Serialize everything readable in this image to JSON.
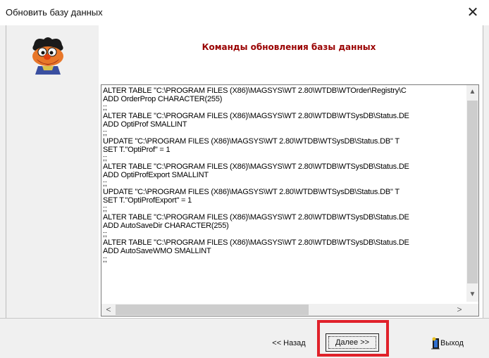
{
  "window": {
    "title": "Обновить базу данных",
    "close_label": "✕"
  },
  "header": {
    "title": "Команды обновления базы данных"
  },
  "sql_text": "ALTER TABLE \"C:\\PROGRAM FILES (X86)\\MAGSYS\\WT 2.80\\WTDB\\WTOrder\\Registry\\C\nADD OrderProp CHARACTER(255)\n;;\nALTER TABLE \"C:\\PROGRAM FILES (X86)\\MAGSYS\\WT 2.80\\WTDB\\WTSysDB\\Status.DE\nADD OptiProf SMALLINT\n;;\nUPDATE \"C:\\PROGRAM FILES (X86)\\MAGSYS\\WT 2.80\\WTDB\\WTSysDB\\Status.DB\" T\nSET T.\"OptiProf\" = 1\n;;\nALTER TABLE \"C:\\PROGRAM FILES (X86)\\MAGSYS\\WT 2.80\\WTDB\\WTSysDB\\Status.DE\nADD OptiProfExport SMALLINT\n;;\nUPDATE \"C:\\PROGRAM FILES (X86)\\MAGSYS\\WT 2.80\\WTDB\\WTSysDB\\Status.DB\" T\nSET T.\"OptiProfExport\" = 1\n;;\nALTER TABLE \"C:\\PROGRAM FILES (X86)\\MAGSYS\\WT 2.80\\WTDB\\WTSysDB\\Status.DE\nADD AutoSaveDir CHARACTER(255)\n;;\nALTER TABLE \"C:\\PROGRAM FILES (X86)\\MAGSYS\\WT 2.80\\WTDB\\WTSysDB\\Status.DE\nADD AutoSaveWMO SMALLINT\n;;",
  "scroll": {
    "up": "▲",
    "down": "▼",
    "left": "<",
    "right": ">"
  },
  "buttons": {
    "back_label": "<< Назад",
    "next_label": "Далее >>",
    "exit_label": "Выход"
  },
  "colors": {
    "heading": "#990000",
    "highlight": "#e0212a"
  }
}
